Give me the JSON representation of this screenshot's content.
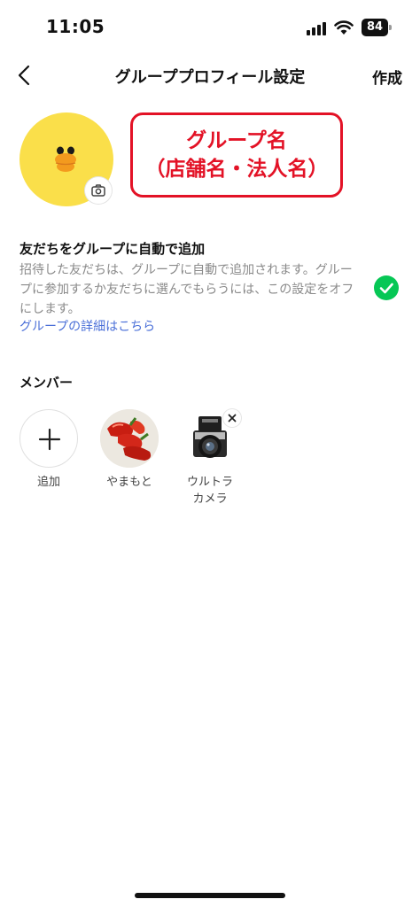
{
  "status_bar": {
    "time": "11:05",
    "battery": "84"
  },
  "nav": {
    "title": "グループプロフィール設定",
    "create_label": "作成"
  },
  "profile": {
    "name_line1": "グループ名",
    "name_line2": "（店舗名・法人名）",
    "accent_color": "#e31226"
  },
  "auto_add": {
    "title": "友だちをグループに自動で追加",
    "description": "招待した友だちは、グループに自動で追加されます。グループに参加するか友だちに選んでもらうには、この設定をオフにします。",
    "link": "グループの詳細はこちら",
    "enabled": true,
    "toggle_color": "#06c755"
  },
  "members": {
    "heading": "メンバー",
    "add_label": "追加",
    "items": [
      {
        "name": "やまもと",
        "icon": "red-peppers-photo"
      },
      {
        "name": "ウルトラ\nカメラ",
        "icon": "camera-photo"
      }
    ]
  }
}
